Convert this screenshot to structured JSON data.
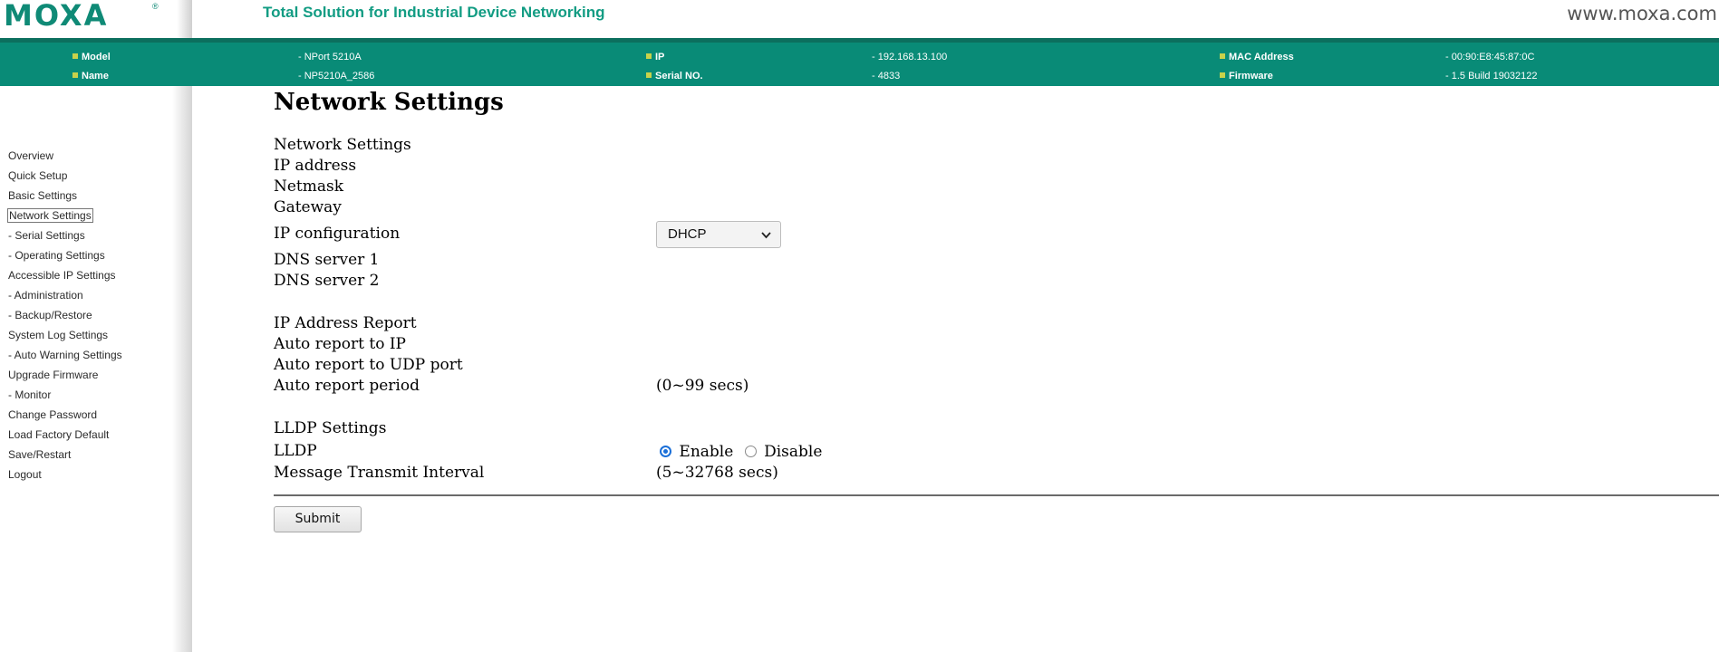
{
  "header": {
    "logo_text": "MOXA",
    "logo_reg": "®",
    "tagline": "Total Solution for Industrial Device Networking",
    "site_url": "www.moxa.com"
  },
  "device_info": {
    "model_label": "Model",
    "model_value": "- NPort 5210A",
    "name_label": "Name",
    "name_value": "- NP5210A_2586",
    "ip_label": "IP",
    "ip_value": "- 192.168.13.100",
    "serial_label": "Serial NO.",
    "serial_value": "- 4833",
    "mac_label": "MAC Address",
    "mac_value": "- 00:90:E8:45:87:0C",
    "firmware_label": "Firmware",
    "firmware_value": "- 1.5 Build 19032122"
  },
  "sidebar": {
    "items": [
      {
        "label": "Overview"
      },
      {
        "label": "Quick Setup"
      },
      {
        "label": "Basic Settings"
      },
      {
        "label": "Network Settings",
        "active": true
      },
      {
        "label": "- Serial Settings"
      },
      {
        "label": "- Operating Settings"
      },
      {
        "label": "Accessible IP Settings"
      },
      {
        "label": "- Administration"
      },
      {
        "label": "- Backup/Restore"
      },
      {
        "label": "System Log Settings"
      },
      {
        "label": "- Auto Warning Settings"
      },
      {
        "label": "Upgrade Firmware"
      },
      {
        "label": "- Monitor"
      },
      {
        "label": "Change Password"
      },
      {
        "label": "Load Factory Default"
      },
      {
        "label": "Save/Restart"
      },
      {
        "label": "Logout"
      }
    ]
  },
  "main": {
    "page_title": "Network Settings",
    "section_network": "Network Settings",
    "ip_address_label": "IP address",
    "netmask_label": "Netmask",
    "gateway_label": "Gateway",
    "ip_config_label": "IP configuration",
    "ip_config_value": "DHCP",
    "dns1_label": "DNS server 1",
    "dns2_label": "DNS server 2",
    "section_ip_report": "IP Address Report",
    "auto_report_ip_label": "Auto report to IP",
    "auto_report_udp_label": "Auto report to UDP port",
    "auto_report_period_label": "Auto report period",
    "auto_report_period_hint": "(0~99 secs)",
    "section_lldp": "LLDP Settings",
    "lldp_label": "LLDP",
    "lldp_enable": "Enable",
    "lldp_disable": "Disable",
    "lldp_selected": "Enable",
    "msg_interval_label": "Message Transmit Interval",
    "msg_interval_hint": "(5~32768 secs)",
    "submit_label": "Submit"
  },
  "colors": {
    "brand_green": "#098b77",
    "header_rule": "#0c6f5e",
    "bullet": "#c8d24b",
    "radio_selected": "#1a6fd8"
  }
}
